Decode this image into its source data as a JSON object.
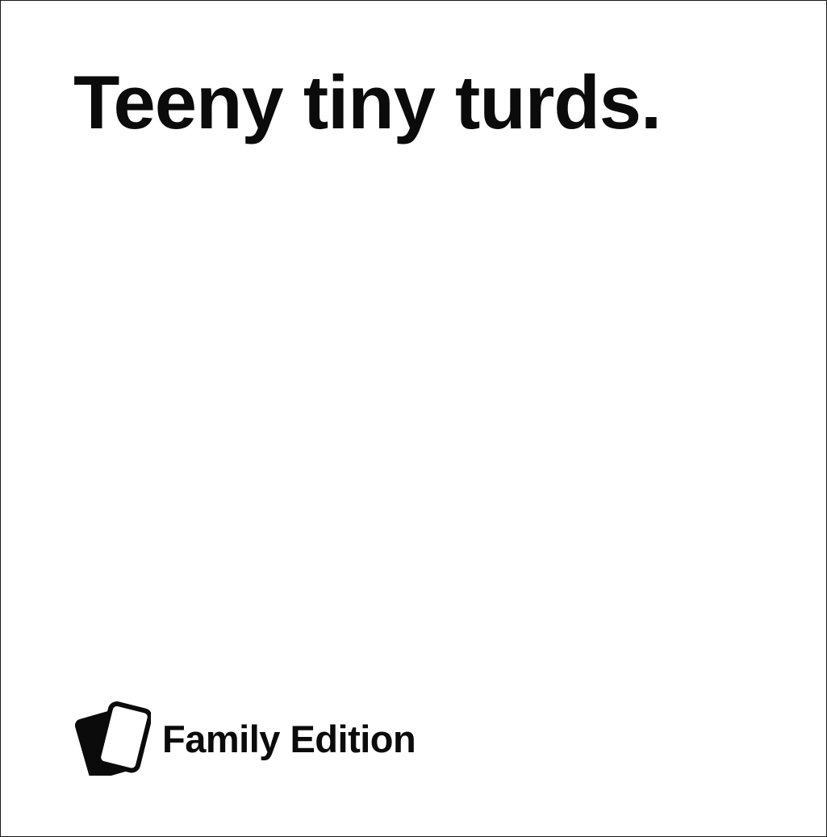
{
  "card": {
    "text": "Teeny tiny turds.",
    "color": "#ffffff",
    "text_color": "#0b0b0b"
  },
  "brand": {
    "icon": "cards-logo-icon",
    "label": "Family Edition"
  }
}
